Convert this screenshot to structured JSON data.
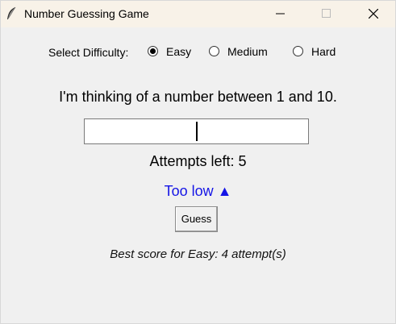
{
  "window": {
    "title": "Number Guessing Game",
    "icons": {
      "app": "feather-icon",
      "minimize": "minimize-icon",
      "maximize": "maximize-icon",
      "close": "close-icon"
    }
  },
  "difficulty": {
    "label": "Select Difficulty:",
    "options": [
      {
        "label": "Easy",
        "selected": true
      },
      {
        "label": "Medium",
        "selected": false
      },
      {
        "label": "Hard",
        "selected": false
      }
    ]
  },
  "game": {
    "prompt": "I'm thinking of a number between 1 and 10.",
    "guess_value": "",
    "attempts_text": "Attempts left: 5",
    "feedback_text": "Too low ▲",
    "feedback_color": "#1414e6",
    "guess_button": "Guess",
    "best_score_text": "Best score for Easy: 4 attempt(s)"
  }
}
